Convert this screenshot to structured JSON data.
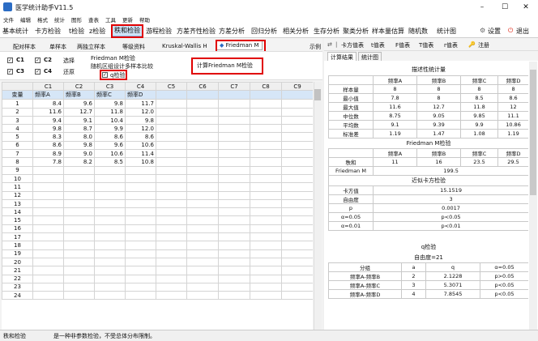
{
  "window": {
    "title": "医学统计助手V11.5",
    "minimize": "–",
    "maximize": "☐",
    "close": "✕"
  },
  "menu": [
    "文件",
    "编辑",
    "格式",
    "统计",
    "图形",
    "查表",
    "工具",
    "更新",
    "帮助"
  ],
  "ribbon": {
    "tabs": [
      "基本统计",
      "卡方检验",
      "t检验",
      "z检验",
      "秩和检验",
      "游程检验",
      "方差齐性检验",
      "方差分析",
      "回归分析",
      "相关分析",
      "生存分析",
      "聚类分析",
      "样本量估算",
      "随机数",
      "统计图"
    ],
    "active_tab": "秩和检验",
    "settings": "设置",
    "exit": "退出"
  },
  "subtabs": {
    "items": [
      "配对样本",
      "单样本",
      "两独立样本",
      "等级资料",
      "Kruskal-Wallis H",
      "Friedman M"
    ],
    "active": "Friedman M",
    "example": "示例"
  },
  "options": {
    "c1": "C1",
    "c2": "C2",
    "c3": "C3",
    "c4": "C4",
    "select": "选择",
    "restore": "还原",
    "line1": "Friedman M检验",
    "line2": "随机区组设计多样本比较",
    "q_test": "q检验",
    "compute_button": "计算Friedman M检验"
  },
  "grid": {
    "columns": [
      "C1",
      "C2",
      "C3",
      "C4",
      "C5",
      "C6",
      "C7",
      "C8",
      "C9"
    ],
    "var_label": "变量",
    "var_names": [
      "频率A",
      "频率B",
      "频率C",
      "频率D"
    ],
    "rows": [
      [
        "8.4",
        "9.6",
        "9.8",
        "11.7"
      ],
      [
        "11.6",
        "12.7",
        "11.8",
        "12.0"
      ],
      [
        "9.4",
        "9.1",
        "10.4",
        "9.8"
      ],
      [
        "9.8",
        "8.7",
        "9.9",
        "12.0"
      ],
      [
        "8.3",
        "8.0",
        "8.6",
        "8.6"
      ],
      [
        "8.6",
        "9.8",
        "9.6",
        "10.6"
      ],
      [
        "8.9",
        "9.0",
        "10.6",
        "11.4"
      ],
      [
        "7.8",
        "8.2",
        "8.5",
        "10.8"
      ]
    ],
    "row_count": 24
  },
  "right_toolbar": {
    "items": [
      "卡方值表",
      "t值表",
      "F值表",
      "T值表",
      "r值表",
      "注册"
    ]
  },
  "right_tabs": [
    "计算结果",
    "统计图"
  ],
  "results": {
    "desc_title": "描述性统计量",
    "desc_cols": [
      "频率A",
      "频率B",
      "频率C",
      "频率D"
    ],
    "desc_rows": [
      {
        "label": "样本量",
        "values": [
          "8",
          "8",
          "8",
          "8"
        ]
      },
      {
        "label": "最小值",
        "values": [
          "7.8",
          "8",
          "8.5",
          "8.6"
        ]
      },
      {
        "label": "最大值",
        "values": [
          "11.6",
          "12.7",
          "11.8",
          "12"
        ]
      },
      {
        "label": "中位数",
        "values": [
          "8.75",
          "9.05",
          "9.85",
          "11.1"
        ]
      },
      {
        "label": "平均数",
        "values": [
          "9.1",
          "9.39",
          "9.9",
          "10.86"
        ]
      },
      {
        "label": "标准差",
        "values": [
          "1.19",
          "1.47",
          "1.08",
          "1.19"
        ]
      }
    ],
    "friedman_title": "Friedman M检验",
    "rank_label": "秩和",
    "rank_values": [
      "11",
      "16",
      "23.5",
      "29.5"
    ],
    "m_label": "Friedman M",
    "m_value": "199.5",
    "chi_title": "近似卡方检验",
    "chi_rows": [
      {
        "label": "卡方值",
        "value": "15.1519"
      },
      {
        "label": "自由度",
        "value": "3"
      },
      {
        "label": "p",
        "value": "0.0017"
      },
      {
        "label": "α=0.05",
        "value": "p<0.05"
      },
      {
        "label": "α=0.01",
        "value": "p<0.01"
      }
    ],
    "q_title": "q检验",
    "q_df": "自由度=21",
    "q_cols": [
      "分组",
      "a",
      "q",
      "α=0.05"
    ],
    "q_rows": [
      [
        "频率A-频率B",
        "2",
        "2.1228",
        "p>0.05"
      ],
      [
        "频率A-频率C",
        "3",
        "5.3071",
        "p<0.05"
      ],
      [
        "频率A-频率D",
        "4",
        "7.8545",
        "p<0.05"
      ]
    ]
  },
  "status": {
    "left": "秩和检验",
    "message": "是一种非参数检验，不受总体分布限制。"
  }
}
